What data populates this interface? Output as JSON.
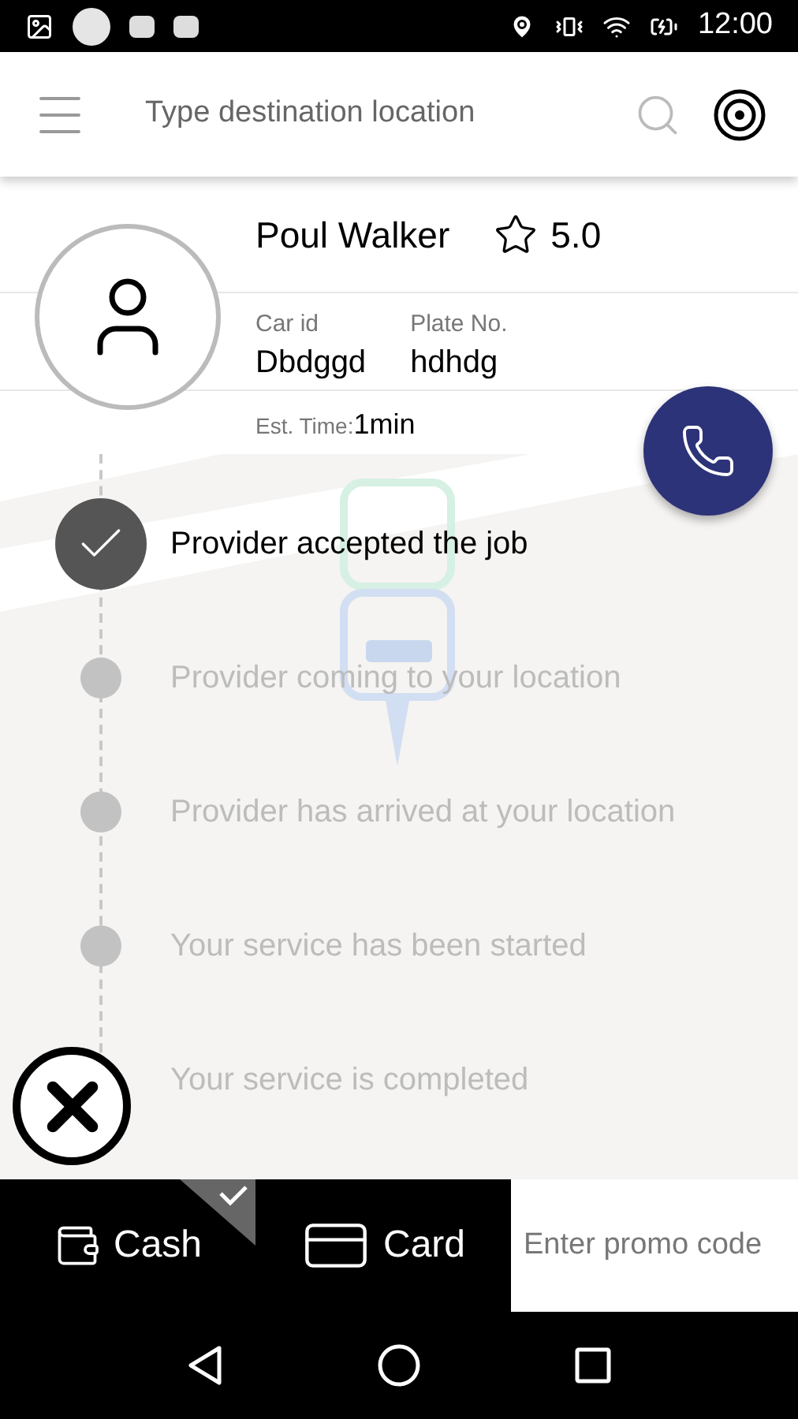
{
  "status_bar": {
    "time": "12:00"
  },
  "search": {
    "placeholder": "Type destination location"
  },
  "driver": {
    "name": "Poul Walker",
    "rating": "5.0",
    "car_id_label": "Car id",
    "car_id": "Dbdggd",
    "plate_label": "Plate No.",
    "plate": "hdhdg",
    "eta_label": "Est. Time:",
    "eta": "1min"
  },
  "steps": [
    {
      "label": "Provider accepted the job",
      "done": true
    },
    {
      "label": "Provider coming to your location",
      "done": false
    },
    {
      "label": "Provider has arrived at your location",
      "done": false
    },
    {
      "label": "Your service has been started",
      "done": false
    },
    {
      "label": "Your service is completed",
      "done": false
    }
  ],
  "payment": [
    {
      "kind": "cash",
      "label": "Cash",
      "selected": true
    },
    {
      "kind": "card",
      "label": "Card",
      "selected": false
    }
  ],
  "promo": {
    "placeholder": "Enter promo code"
  }
}
